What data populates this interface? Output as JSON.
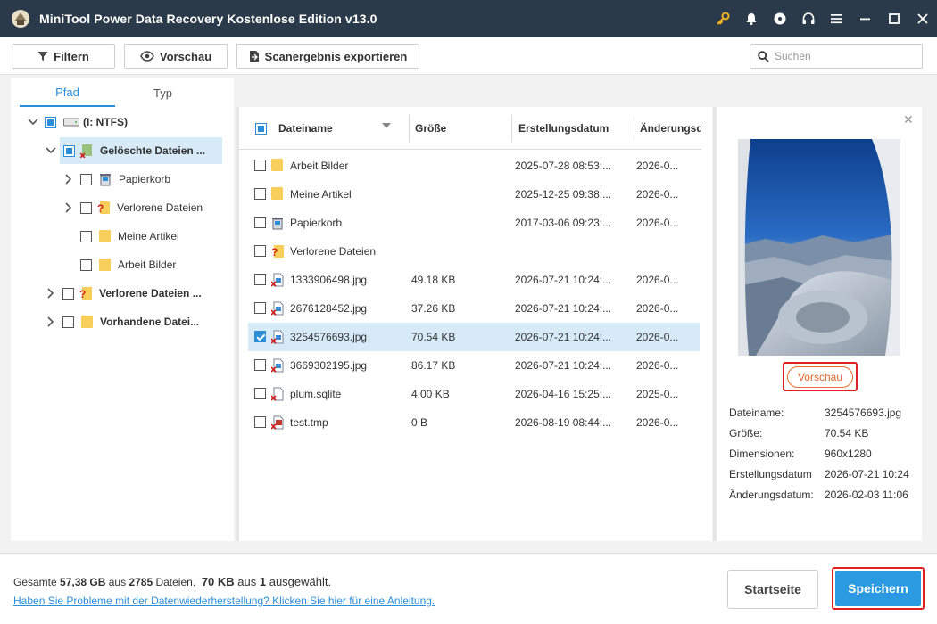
{
  "window": {
    "title": "MiniTool Power Data Recovery Kostenlose Edition v13.0"
  },
  "toolbar": {
    "filter_label": "Filtern",
    "preview_label": "Vorschau",
    "export_label": "Scanergebnis exportieren",
    "search_placeholder": "Suchen"
  },
  "tabs": {
    "path": "Pfad",
    "type": "Typ"
  },
  "tree": [
    {
      "label": "(I: NTFS)"
    },
    {
      "label": "Gelöschte Dateien ..."
    },
    {
      "label": "Papierkorb"
    },
    {
      "label": "Verlorene Dateien"
    },
    {
      "label": "Meine Artikel"
    },
    {
      "label": "Arbeit Bilder"
    },
    {
      "label": "Verlorene Dateien ..."
    },
    {
      "label": "Vorhandene Datei..."
    }
  ],
  "table": {
    "columns": [
      "Dateiname",
      "Größe",
      "Erstellungsdatum",
      "Änderungsd"
    ],
    "rows": [
      {
        "name": "Arbeit Bilder",
        "size": "",
        "created": "2025-07-28 08:53:...",
        "modified": "2026-0...",
        "kind": "folder"
      },
      {
        "name": "Meine Artikel",
        "size": "",
        "created": "2025-12-25 09:38:...",
        "modified": "2026-0...",
        "kind": "folder"
      },
      {
        "name": "Papierkorb",
        "size": "",
        "created": "2017-03-06 09:23:...",
        "modified": "2026-0...",
        "kind": "recycle"
      },
      {
        "name": "Verlorene Dateien",
        "size": "",
        "created": "",
        "modified": "",
        "kind": "lost"
      },
      {
        "name": "1333906498.jpg",
        "size": "49.18 KB",
        "created": "2026-07-21 10:24:...",
        "modified": "2026-0...",
        "kind": "image"
      },
      {
        "name": "2676128452.jpg",
        "size": "37.26 KB",
        "created": "2026-07-21 10:24:...",
        "modified": "2026-0...",
        "kind": "image"
      },
      {
        "name": "3254576693.jpg",
        "size": "70.54 KB",
        "created": "2026-07-21 10:24:...",
        "modified": "2026-0...",
        "kind": "image"
      },
      {
        "name": "3669302195.jpg",
        "size": "86.17 KB",
        "created": "2026-07-21 10:24:...",
        "modified": "2026-0...",
        "kind": "image"
      },
      {
        "name": "plum.sqlite",
        "size": "4.00 KB",
        "created": "2026-04-16 15:25:...",
        "modified": "2025-0...",
        "kind": "file"
      },
      {
        "name": "test.tmp",
        "size": "0 B",
        "created": "2026-08-19 08:44:...",
        "modified": "2026-0...",
        "kind": "tmp"
      }
    ]
  },
  "preview": {
    "button_label": "Vorschau",
    "meta": [
      {
        "key": "Dateiname:",
        "value": "3254576693.jpg"
      },
      {
        "key": "Größe:",
        "value": "70.54 KB"
      },
      {
        "key": "Dimensionen:",
        "value": "960x1280"
      },
      {
        "key": "Erstellungsdatum",
        "value": "2026-07-21 10:24"
      },
      {
        "key": "Änderungsdatum:",
        "value": "2026-02-03 11:06"
      }
    ]
  },
  "status": {
    "total_prefix": "Gesamte ",
    "total_size": "57,38 GB",
    "mid": " aus ",
    "file_count": "2785",
    "files_suffix": " Dateien.",
    "selected_size": "70 KB",
    "selected_mid": " aus ",
    "selected_count": "1",
    "selected_suffix": " ausgewählt."
  },
  "help_link": "Haben Sie Probleme mit der Datenwiederherstellung? Klicken Sie hier für eine Anleitung.",
  "buttons": {
    "home": "Startseite",
    "save": "Speichern"
  },
  "colors": {
    "titlebar": "#2b3a4a",
    "accent": "#2a9be0",
    "highlight_border": "#e02020",
    "preview_orange": "#e46a2e",
    "selected_row": "#d6eaf8"
  }
}
